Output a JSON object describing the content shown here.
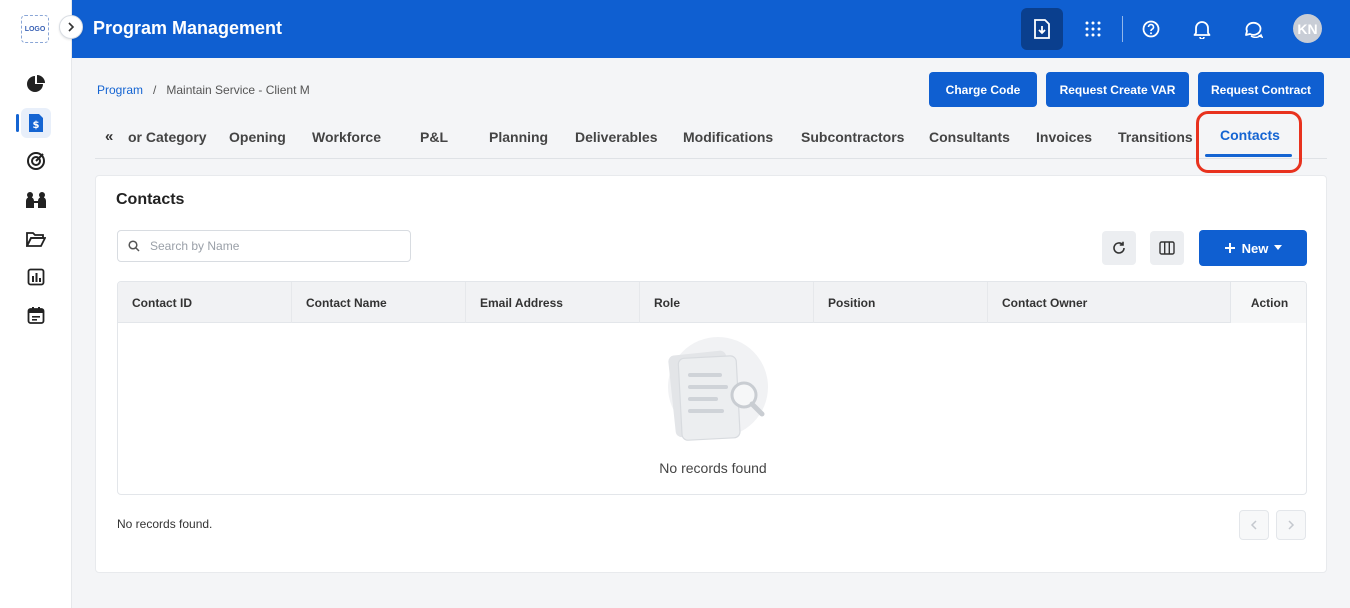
{
  "sidebar": {
    "logo_text": "LOGO",
    "items": [
      {
        "icon": "pie-chart-icon"
      },
      {
        "icon": "dollar-document-icon",
        "active": true
      },
      {
        "icon": "target-icon"
      },
      {
        "icon": "team-icon"
      },
      {
        "icon": "folder-open-icon"
      },
      {
        "icon": "bar-report-icon"
      },
      {
        "icon": "calendar-icon"
      }
    ]
  },
  "header": {
    "title": "Program Management",
    "icons": [
      "download-doc-icon",
      "apps-grid-icon",
      "help-icon",
      "bell-icon",
      "chat-icon"
    ],
    "avatar_initials": "KN",
    "accent_color": "#0f5fd1"
  },
  "breadcrumb": {
    "root": "Program",
    "separator": "/",
    "current": "Maintain Service - Client M"
  },
  "actions": {
    "charge_code": "Charge Code",
    "request_create_var": "Request Create VAR",
    "request_contract": "Request Contract"
  },
  "tabs": {
    "scroll_glyph": "«",
    "items": [
      {
        "label": "or Category"
      },
      {
        "label": "Opening"
      },
      {
        "label": "Workforce"
      },
      {
        "label": "P&L"
      },
      {
        "label": "Planning"
      },
      {
        "label": "Deliverables"
      },
      {
        "label": "Modifications"
      },
      {
        "label": "Subcontractors"
      },
      {
        "label": "Consultants"
      },
      {
        "label": "Invoices"
      },
      {
        "label": "Transitions"
      },
      {
        "label": "Contacts",
        "active": true
      }
    ]
  },
  "panel": {
    "title": "Contacts",
    "search_placeholder": "Search by Name",
    "new_label": "New",
    "columns": [
      "Contact ID",
      "Contact Name",
      "Email Address",
      "Role",
      "Position",
      "Contact Owner",
      "Action"
    ],
    "empty_text": "No records found",
    "footer_text": "No records found."
  }
}
